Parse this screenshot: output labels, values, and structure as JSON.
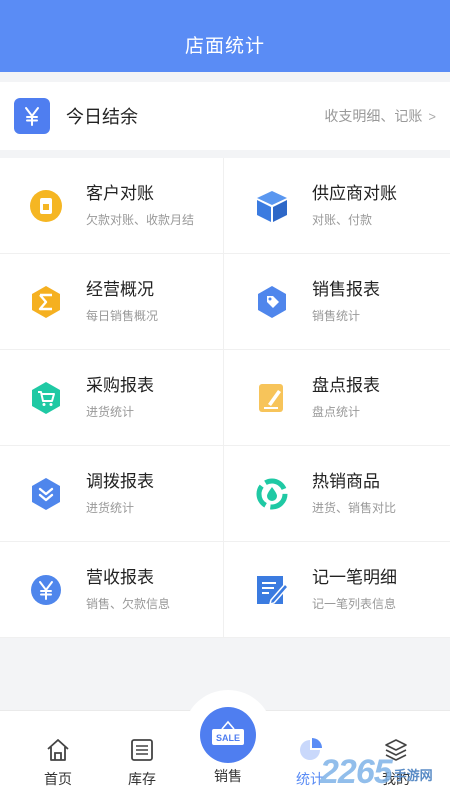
{
  "header": {
    "title": "店面统计"
  },
  "balance": {
    "icon": "yen-icon",
    "label": "今日结余",
    "link": "收支明细、记账",
    "chevron": ">"
  },
  "grid": [
    {
      "title": "客户对账",
      "subtitle": "欠款对账、收款月结",
      "icon": "coin-icon",
      "color": "#f5b623"
    },
    {
      "title": "供应商对账",
      "subtitle": "对账、付款",
      "icon": "box-icon",
      "color": "#3b7be0"
    },
    {
      "title": "经营概况",
      "subtitle": "每日销售概况",
      "icon": "sigma-icon",
      "color": "#f5b020"
    },
    {
      "title": "销售报表",
      "subtitle": "销售统计",
      "icon": "tag-icon",
      "color": "#4f86ec"
    },
    {
      "title": "采购报表",
      "subtitle": "进货统计",
      "icon": "cart-icon",
      "color": "#1fc9a4"
    },
    {
      "title": "盘点报表",
      "subtitle": "盘点统计",
      "icon": "pencil-doc-icon",
      "color": "#f7c45a"
    },
    {
      "title": "调拨报表",
      "subtitle": "进货统计",
      "icon": "transfer-icon",
      "color": "#4f86ec"
    },
    {
      "title": "热销商品",
      "subtitle": "进货、销售对比",
      "icon": "drop-cycle-icon",
      "color": "#1fc9a4"
    },
    {
      "title": "营收报表",
      "subtitle": "销售、欠款信息",
      "icon": "yen-circle-icon",
      "color": "#4f86ec"
    },
    {
      "title": "记一笔明细",
      "subtitle": "记一笔列表信息",
      "icon": "note-edit-icon",
      "color": "#3b7be0"
    }
  ],
  "tabs": {
    "home": "首页",
    "stock": "库存",
    "sale": "销售",
    "sale_badge": "SALE",
    "stats": "统计",
    "mine": "我的"
  },
  "watermark": {
    "num": "2265",
    "text": "手游网"
  },
  "colors": {
    "primary": "#5a8cf5",
    "accent": "#4f7ef0"
  }
}
